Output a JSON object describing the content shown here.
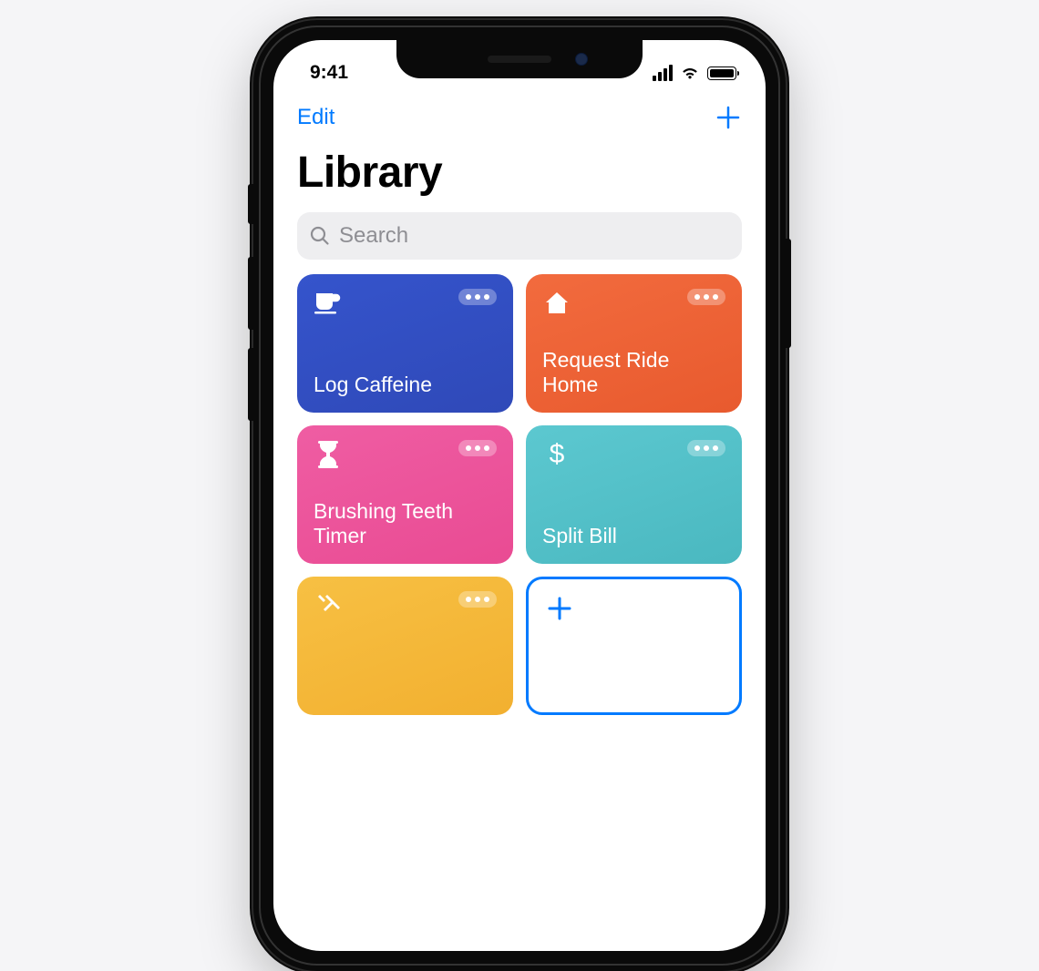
{
  "status": {
    "time": "9:41"
  },
  "nav": {
    "edit": "Edit"
  },
  "title": "Library",
  "search": {
    "placeholder": "Search"
  },
  "colors": {
    "accent": "#007aff",
    "card_blue": "#3051c8",
    "card_orange": "#ed6036",
    "card_pink": "#ec529a",
    "card_teal": "#53c1ca",
    "card_yellow": "#f5ba3d"
  },
  "cards": [
    {
      "label": "Log Caffeine",
      "icon": "cup",
      "color": "blue"
    },
    {
      "label": "Request Ride Home",
      "icon": "home",
      "color": "orange"
    },
    {
      "label": "Brushing Teeth Timer",
      "icon": "hourglass",
      "color": "pink"
    },
    {
      "label": "Split Bill",
      "icon": "dollar",
      "color": "teal"
    },
    {
      "label": "",
      "icon": "fork",
      "color": "yellow"
    },
    {
      "label": "",
      "icon": "plus",
      "color": "white"
    }
  ]
}
